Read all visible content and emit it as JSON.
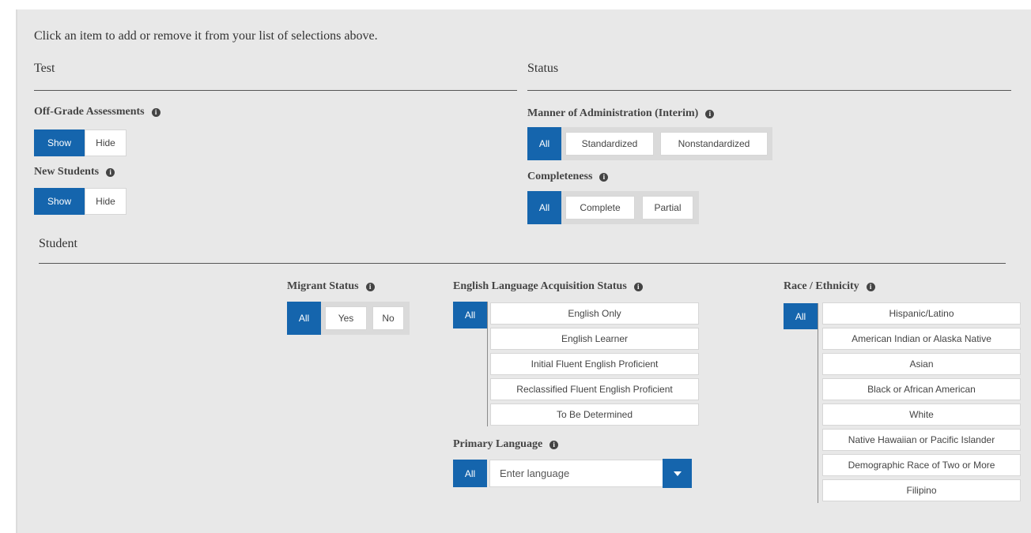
{
  "intro_text": "Click an item to add or remove it from your list of selections above.",
  "sections": {
    "test": "Test",
    "status": "Status",
    "student": "Student"
  },
  "test": {
    "off_grade": {
      "label": "Off-Grade Assessments",
      "options": [
        "Show",
        "Hide"
      ],
      "selected": "Show"
    },
    "new_students": {
      "label": "New Students",
      "options": [
        "Show",
        "Hide"
      ],
      "selected": "Show"
    }
  },
  "status": {
    "manner": {
      "label": "Manner of Administration (Interim)",
      "options": [
        "All",
        "Standardized",
        "Nonstandardized"
      ],
      "selected": "All"
    },
    "completeness": {
      "label": "Completeness",
      "options": [
        "All",
        "Complete",
        "Partial"
      ],
      "selected": "All"
    }
  },
  "student": {
    "migrant": {
      "label": "Migrant Status",
      "options": [
        "All",
        "Yes",
        "No"
      ],
      "selected": "All"
    },
    "ela": {
      "label": "English Language Acquisition Status",
      "all": "All",
      "options": [
        "English Only",
        "English Learner",
        "Initial Fluent English Proficient",
        "Reclassified Fluent English Proficient",
        "To Be Determined"
      ],
      "selected": "All"
    },
    "primary_language": {
      "label": "Primary Language",
      "all": "All",
      "placeholder": "Enter language"
    },
    "race": {
      "label": "Race / Ethnicity",
      "all": "All",
      "options": [
        "Hispanic/Latino",
        "American Indian or Alaska Native",
        "Asian",
        "Black or African American",
        "White",
        "Native Hawaiian or Pacific Islander",
        "Demographic Race of Two or More",
        "Filipino"
      ],
      "selected": "All"
    }
  },
  "icons": {
    "info": "info-circle-icon",
    "dropdown": "caret-down-icon"
  },
  "colors": {
    "accent": "#1565ad",
    "panel": "#e8e8e8"
  }
}
